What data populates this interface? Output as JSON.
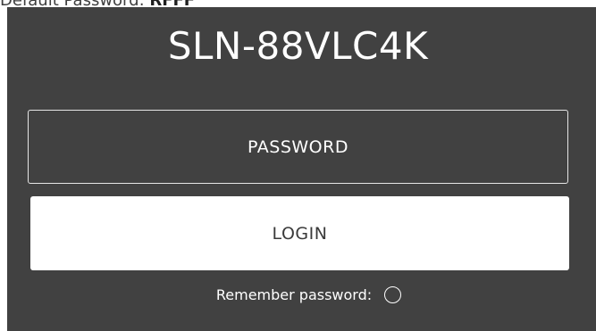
{
  "hint": {
    "prefix": "Default Password: ",
    "password": "RFFF"
  },
  "login": {
    "title": "SLN-88VLC4K",
    "password_placeholder": "PASSWORD",
    "button_label": "LOGIN",
    "remember_label": "Remember password:",
    "remember_checked": false
  },
  "colors": {
    "panel_background": "#414141",
    "text": "#ffffff",
    "button_background": "#ffffff",
    "button_text": "#3a3a3a"
  },
  "icons": {
    "remember_toggle": "radio-circle-icon"
  }
}
